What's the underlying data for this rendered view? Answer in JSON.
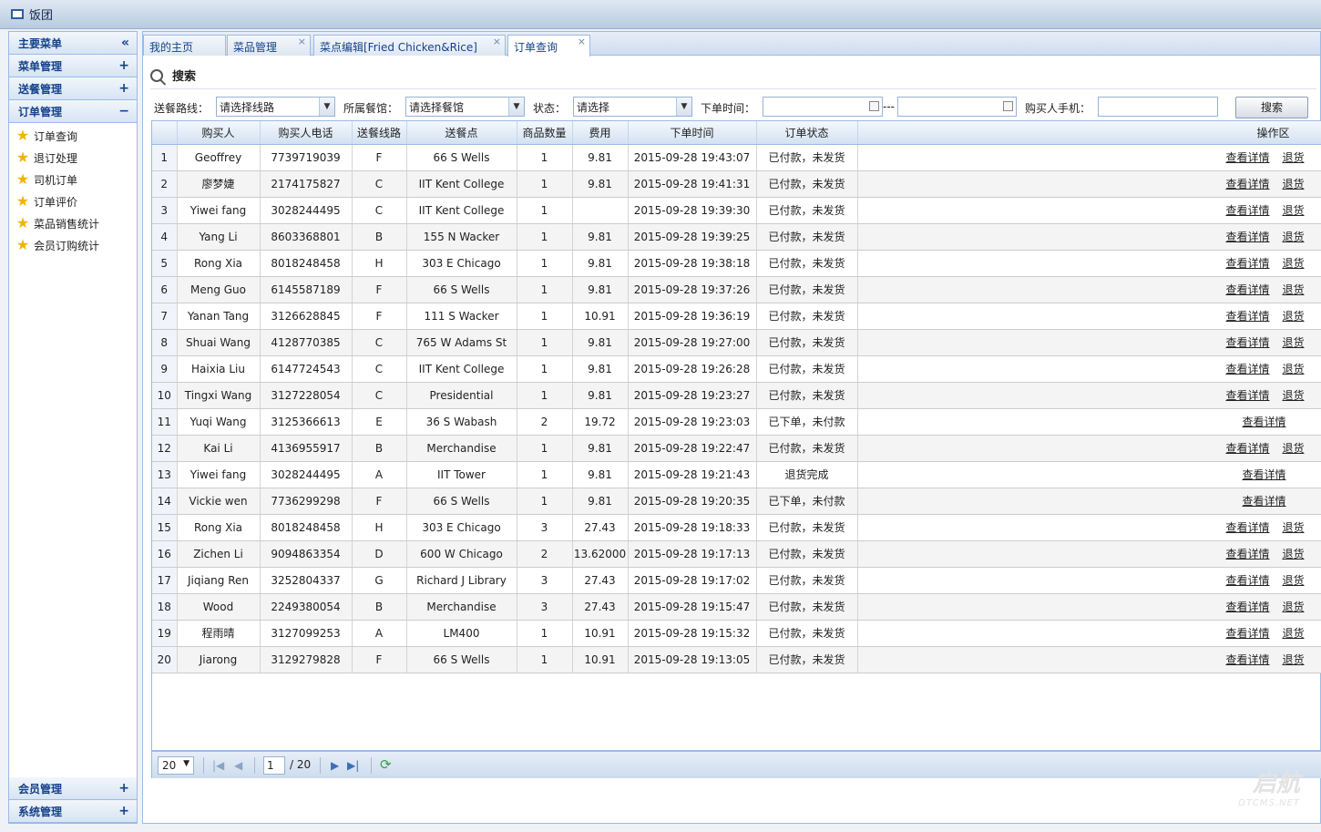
{
  "app": {
    "title": "饭团"
  },
  "sidebar": {
    "main_menu": "主要菜单",
    "main_menu_toggle": "«",
    "sections_top": [
      {
        "label": "菜单管理",
        "toggle": "+"
      },
      {
        "label": "送餐管理",
        "toggle": "+"
      },
      {
        "label": "订单管理",
        "toggle": "−"
      }
    ],
    "items": [
      "订单查询",
      "退订处理",
      "司机订单",
      "订单评价",
      "菜品销售统计",
      "会员订购统计"
    ],
    "sections_bottom": [
      {
        "label": "会员管理",
        "toggle": "+"
      },
      {
        "label": "系统管理",
        "toggle": "+"
      }
    ]
  },
  "tabs": [
    {
      "label": "我的主页",
      "close": ""
    },
    {
      "label": "菜品管理",
      "close": "×"
    },
    {
      "label": "菜点编辑[Fried Chicken&Rice]",
      "close": "×"
    },
    {
      "label": "订单查询",
      "close": "×"
    }
  ],
  "search": {
    "title": "搜索",
    "route_label": "送餐路线：",
    "route_value": "请选择线路",
    "restaurant_label": "所属餐馆：",
    "restaurant_value": "请选择餐馆",
    "status_label": "状态：",
    "status_value": "请选择",
    "time_label": "下单时间：",
    "time_sep": "---",
    "phone_label": "购买人手机：",
    "search_button": "搜索"
  },
  "table": {
    "columns": [
      "",
      "购买人",
      "购买人电话",
      "送餐线路",
      "送餐点",
      "商品数量",
      "费用",
      "下单时间",
      "订单状态",
      "操作区"
    ],
    "detail_label": "查看详情",
    "refund_label": "退货",
    "rows": [
      {
        "n": "1",
        "buyer": "Geoffrey",
        "phone": "7739719039",
        "route": "F",
        "point": "66 S Wells",
        "qty": "1",
        "fee": "9.81",
        "time": "2015-09-28 19:43:07",
        "status": "已付款，未发货",
        "refund": true
      },
      {
        "n": "2",
        "buyer": "廖梦婕",
        "phone": "2174175827",
        "route": "C",
        "point": "IIT Kent College",
        "qty": "1",
        "fee": "9.81",
        "time": "2015-09-28 19:41:31",
        "status": "已付款，未发货",
        "refund": true
      },
      {
        "n": "3",
        "buyer": "Yiwei fang",
        "phone": "3028244495",
        "route": "C",
        "point": "IIT Kent College",
        "qty": "1",
        "fee": "",
        "time": "2015-09-28 19:39:30",
        "status": "已付款，未发货",
        "refund": true
      },
      {
        "n": "4",
        "buyer": "Yang Li",
        "phone": "8603368801",
        "route": "B",
        "point": "155 N Wacker",
        "qty": "1",
        "fee": "9.81",
        "time": "2015-09-28 19:39:25",
        "status": "已付款，未发货",
        "refund": true
      },
      {
        "n": "5",
        "buyer": "Rong Xia",
        "phone": "8018248458",
        "route": "H",
        "point": "303 E Chicago",
        "qty": "1",
        "fee": "9.81",
        "time": "2015-09-28 19:38:18",
        "status": "已付款，未发货",
        "refund": true
      },
      {
        "n": "6",
        "buyer": "Meng Guo",
        "phone": "6145587189",
        "route": "F",
        "point": "66 S Wells",
        "qty": "1",
        "fee": "9.81",
        "time": "2015-09-28 19:37:26",
        "status": "已付款，未发货",
        "refund": true
      },
      {
        "n": "7",
        "buyer": "Yanan Tang",
        "phone": "3126628845",
        "route": "F",
        "point": "111 S Wacker",
        "qty": "1",
        "fee": "10.91",
        "time": "2015-09-28 19:36:19",
        "status": "已付款，未发货",
        "refund": true
      },
      {
        "n": "8",
        "buyer": "Shuai Wang",
        "phone": "4128770385",
        "route": "C",
        "point": "765 W Adams St",
        "qty": "1",
        "fee": "9.81",
        "time": "2015-09-28 19:27:00",
        "status": "已付款，未发货",
        "refund": true
      },
      {
        "n": "9",
        "buyer": "Haixia Liu",
        "phone": "6147724543",
        "route": "C",
        "point": "IIT Kent College",
        "qty": "1",
        "fee": "9.81",
        "time": "2015-09-28 19:26:28",
        "status": "已付款，未发货",
        "refund": true
      },
      {
        "n": "10",
        "buyer": "Tingxi Wang",
        "phone": "3127228054",
        "route": "C",
        "point": "Presidential",
        "qty": "1",
        "fee": "9.81",
        "time": "2015-09-28 19:23:27",
        "status": "已付款，未发货",
        "refund": true
      },
      {
        "n": "11",
        "buyer": "Yuqi Wang",
        "phone": "3125366613",
        "route": "E",
        "point": "36 S Wabash",
        "qty": "2",
        "fee": "19.72",
        "time": "2015-09-28 19:23:03",
        "status": "已下单，未付款",
        "refund": false
      },
      {
        "n": "12",
        "buyer": "Kai Li",
        "phone": "4136955917",
        "route": "B",
        "point": "Merchandise",
        "qty": "1",
        "fee": "9.81",
        "time": "2015-09-28 19:22:47",
        "status": "已付款，未发货",
        "refund": true
      },
      {
        "n": "13",
        "buyer": "Yiwei fang",
        "phone": "3028244495",
        "route": "A",
        "point": "IIT Tower",
        "qty": "1",
        "fee": "9.81",
        "time": "2015-09-28 19:21:43",
        "status": "退货完成",
        "refund": false
      },
      {
        "n": "14",
        "buyer": "Vickie wen",
        "phone": "7736299298",
        "route": "F",
        "point": "66 S Wells",
        "qty": "1",
        "fee": "9.81",
        "time": "2015-09-28 19:20:35",
        "status": "已下单，未付款",
        "refund": false
      },
      {
        "n": "15",
        "buyer": "Rong Xia",
        "phone": "8018248458",
        "route": "H",
        "point": "303 E Chicago",
        "qty": "3",
        "fee": "27.43",
        "time": "2015-09-28 19:18:33",
        "status": "已付款，未发货",
        "refund": true
      },
      {
        "n": "16",
        "buyer": "Zichen Li",
        "phone": "9094863354",
        "route": "D",
        "point": "600 W Chicago",
        "qty": "2",
        "fee": "13.62000",
        "time": "2015-09-28 19:17:13",
        "status": "已付款，未发货",
        "refund": true
      },
      {
        "n": "17",
        "buyer": "Jiqiang Ren",
        "phone": "3252804337",
        "route": "G",
        "point": "Richard J Library",
        "qty": "3",
        "fee": "27.43",
        "time": "2015-09-28 19:17:02",
        "status": "已付款，未发货",
        "refund": true
      },
      {
        "n": "18",
        "buyer": "Wood",
        "phone": "2249380054",
        "route": "B",
        "point": "Merchandise",
        "qty": "3",
        "fee": "27.43",
        "time": "2015-09-28 19:15:47",
        "status": "已付款，未发货",
        "refund": true
      },
      {
        "n": "19",
        "buyer": "程雨晴",
        "phone": "3127099253",
        "route": "A",
        "point": "LM400",
        "qty": "1",
        "fee": "10.91",
        "time": "2015-09-28 19:15:32",
        "status": "已付款，未发货",
        "refund": true
      },
      {
        "n": "20",
        "buyer": "Jiarong",
        "phone": "3129279828",
        "route": "F",
        "point": "66 S Wells",
        "qty": "1",
        "fee": "10.91",
        "time": "2015-09-28 19:13:05",
        "status": "已付款，未发货",
        "refund": true
      }
    ]
  },
  "pager": {
    "page_size": "20",
    "current_page": "1",
    "total": "/ 20"
  },
  "watermark": {
    "brand": "启航",
    "domain": "DTCMS.NET"
  }
}
